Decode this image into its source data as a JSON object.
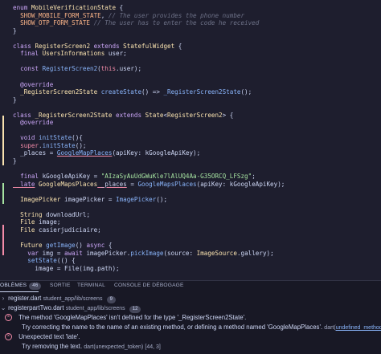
{
  "editor": {
    "lines": [
      {
        "tokens": [
          {
            "c": "kw",
            "t": "enum "
          },
          {
            "c": "ty",
            "t": "MobileVerificationState"
          },
          {
            "c": "pl",
            "t": " {"
          }
        ]
      },
      {
        "tokens": [
          {
            "c": "cn",
            "t": "  SHOW_MOBILE_FORM_STATE"
          },
          {
            "c": "pl",
            "t": ", "
          },
          {
            "c": "cm",
            "t": "// The user provides the phone number"
          }
        ]
      },
      {
        "tokens": [
          {
            "c": "cn",
            "t": "  SHOW_OTP_FORM_STATE"
          },
          {
            "c": "pl",
            "t": " "
          },
          {
            "c": "cm",
            "t": "// The user has to enter the code he received"
          }
        ]
      },
      {
        "tokens": [
          {
            "c": "pl",
            "t": "}"
          }
        ]
      },
      {
        "tokens": []
      },
      {
        "tokens": [
          {
            "c": "kw",
            "t": "class "
          },
          {
            "c": "ty",
            "t": "RegisterScreen2"
          },
          {
            "c": "kw",
            "t": " extends "
          },
          {
            "c": "ty",
            "t": "StatefulWidget"
          },
          {
            "c": "pl",
            "t": " {"
          }
        ]
      },
      {
        "tokens": [
          {
            "c": "kw",
            "t": "  final "
          },
          {
            "c": "ty",
            "t": "UsersInformations"
          },
          {
            "c": "pl",
            "t": " user;"
          }
        ]
      },
      {
        "tokens": []
      },
      {
        "tokens": [
          {
            "c": "kw",
            "t": "  const "
          },
          {
            "c": "fn",
            "t": "RegisterScreen2"
          },
          {
            "c": "pl",
            "t": "("
          },
          {
            "c": "th",
            "t": "this"
          },
          {
            "c": "pl",
            "t": ".user);"
          }
        ]
      },
      {
        "tokens": []
      },
      {
        "tokens": [
          {
            "c": "an",
            "t": "  @override"
          }
        ]
      },
      {
        "tokens": [
          {
            "c": "ty",
            "t": "  _RegisterScreen2State"
          },
          {
            "c": "pl",
            "t": " "
          },
          {
            "c": "fn",
            "t": "createState"
          },
          {
            "c": "pl",
            "t": "() => "
          },
          {
            "c": "fn",
            "t": "_RegisterScreen2State"
          },
          {
            "c": "pl",
            "t": "();"
          }
        ]
      },
      {
        "tokens": [
          {
            "c": "pl",
            "t": "}"
          }
        ]
      },
      {
        "tokens": []
      },
      {
        "tokens": [
          {
            "c": "kw",
            "t": "class "
          },
          {
            "c": "ty",
            "t": "_RegisterScreen2State"
          },
          {
            "c": "kw",
            "t": " extends "
          },
          {
            "c": "ty",
            "t": "State"
          },
          {
            "c": "pl",
            "t": "<"
          },
          {
            "c": "ty",
            "t": "RegisterScreen2"
          },
          {
            "c": "pl",
            "t": "> {"
          }
        ]
      },
      {
        "tokens": [
          {
            "c": "an",
            "t": "  @override"
          }
        ]
      },
      {
        "tokens": []
      },
      {
        "tokens": [
          {
            "c": "kw",
            "t": "  void "
          },
          {
            "c": "fn",
            "t": "initState"
          },
          {
            "c": "pl",
            "t": "(){"
          }
        ]
      },
      {
        "tokens": [
          {
            "c": "th",
            "t": "  super"
          },
          {
            "c": "pl",
            "t": "."
          },
          {
            "c": "fn",
            "t": "initState"
          },
          {
            "c": "pl",
            "t": "();"
          }
        ]
      },
      {
        "tokens": [
          {
            "c": "pl",
            "t": "  _places = "
          },
          {
            "c": "fn ul",
            "t": "GoogleMapPlaces"
          },
          {
            "c": "pl",
            "t": "(apiKey: kGoogleApiKey);"
          }
        ]
      },
      {
        "tokens": [
          {
            "c": "pl",
            "t": "}"
          }
        ]
      },
      {
        "tokens": []
      },
      {
        "tokens": [
          {
            "c": "kw",
            "t": "  final "
          },
          {
            "c": "pl",
            "t": "kGoogleApiKey = "
          },
          {
            "c": "st",
            "t": "\"AIzaSyAuUdGWuKle7lAlUQ4Aa-G35ORCQ_LFSzg\""
          },
          {
            "c": "pl",
            "t": ";"
          }
        ]
      },
      {
        "tokens": [
          {
            "c": "kw ul",
            "t": "  late"
          },
          {
            "c": "pl",
            "t": " "
          },
          {
            "c": "ty",
            "t": "GoogleMapsPlaces"
          },
          {
            "c": "pl ul",
            "t": " _places"
          },
          {
            "c": "pl",
            "t": " = "
          },
          {
            "c": "fn",
            "t": "GoogleMapsPlaces"
          },
          {
            "c": "pl",
            "t": "(apiKey: kGoogleApiKey);"
          }
        ]
      },
      {
        "tokens": []
      },
      {
        "tokens": [
          {
            "c": "ty",
            "t": "  ImagePicker"
          },
          {
            "c": "pl",
            "t": " imagePicker = "
          },
          {
            "c": "fn",
            "t": "ImagePicker"
          },
          {
            "c": "pl",
            "t": "();"
          }
        ]
      },
      {
        "tokens": []
      },
      {
        "tokens": [
          {
            "c": "ty",
            "t": "  String"
          },
          {
            "c": "pl",
            "t": " downloadUrl;"
          }
        ]
      },
      {
        "tokens": [
          {
            "c": "ty",
            "t": "  File"
          },
          {
            "c": "pl",
            "t": " image;"
          }
        ]
      },
      {
        "tokens": [
          {
            "c": "ty",
            "t": "  File"
          },
          {
            "c": "pl",
            "t": " casierjudiciaire;"
          }
        ]
      },
      {
        "tokens": []
      },
      {
        "tokens": [
          {
            "c": "ty",
            "t": "  Future"
          },
          {
            "c": "pl",
            "t": " "
          },
          {
            "c": "fn",
            "t": "getImage"
          },
          {
            "c": "pl",
            "t": "() "
          },
          {
            "c": "kw",
            "t": "async"
          },
          {
            "c": "pl",
            "t": " {"
          }
        ]
      },
      {
        "tokens": [
          {
            "c": "kw",
            "t": "    var "
          },
          {
            "c": "pl",
            "t": "img = "
          },
          {
            "c": "kw",
            "t": "await "
          },
          {
            "c": "pl",
            "t": "imagePicker."
          },
          {
            "c": "fn",
            "t": "pickImage"
          },
          {
            "c": "pl",
            "t": "(source: "
          },
          {
            "c": "ty",
            "t": "ImageSource"
          },
          {
            "c": "pl",
            "t": ".gallery);"
          }
        ]
      },
      {
        "tokens": [
          {
            "c": "fn",
            "t": "    setState"
          },
          {
            "c": "pl",
            "t": "(() {"
          }
        ]
      },
      {
        "tokens": [
          {
            "c": "pl",
            "t": "      image = File(img.path);"
          }
        ]
      }
    ]
  },
  "panel": {
    "tabs": [
      {
        "label": "OBLÈMES",
        "badge": "46",
        "active": true
      },
      {
        "label": "SORTIE",
        "badge": "",
        "active": false
      },
      {
        "label": "TERMINAL",
        "badge": "",
        "active": false
      },
      {
        "label": "CONSOLE DE DÉBOGAGE",
        "badge": "",
        "active": false
      }
    ],
    "files": [
      {
        "name": "register.dart",
        "path": "student_app/lib/screens",
        "count": "9"
      },
      {
        "name": "registerpartTwo.dart",
        "path": "student_app/lib/screens",
        "count": "12"
      }
    ],
    "problems": [
      {
        "message": "The method 'GoogleMapPlaces' isn't defined for the type '_RegisterScreen2State'."
      },
      {
        "hint": "Try correcting the name to the name of an existing method, or defining a method named 'GoogleMapPlaces'.",
        "source": "dart(",
        "link": "undefined_method"
      },
      {
        "message": "Unexpected text 'late'."
      },
      {
        "hint": "Try removing the text.",
        "source": "dart(unexpected_token)",
        "location": "[44, 3]"
      }
    ]
  }
}
